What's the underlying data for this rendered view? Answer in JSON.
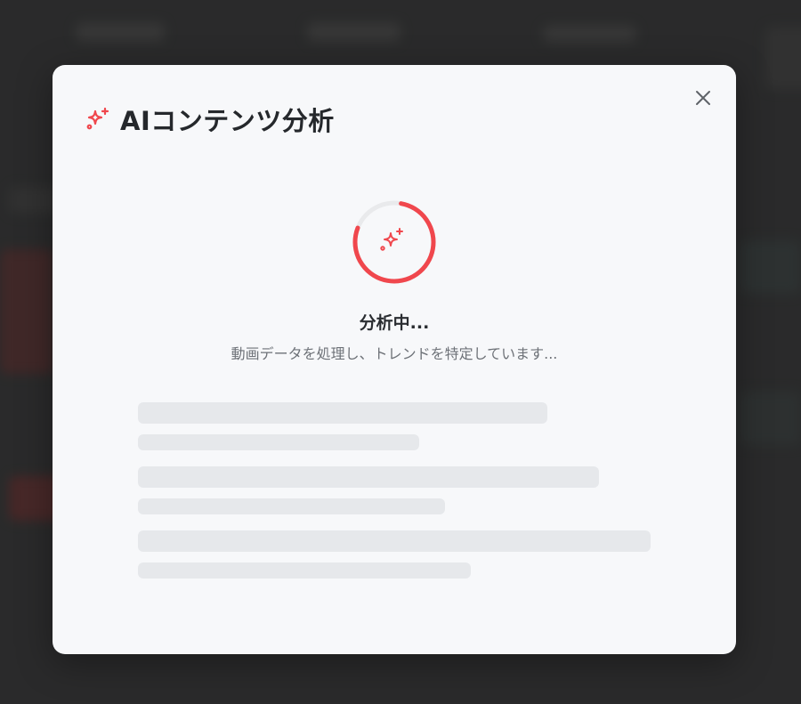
{
  "modal": {
    "title": "AIコンテンツ分析",
    "close_label": "×",
    "status_title": "分析中...",
    "status_subtitle": "動画データを処理し、トレンドを特定しています..."
  },
  "progress": {
    "fraction": 0.78
  },
  "colors": {
    "accent": "#f0474d",
    "skeleton": "#e6e8eb",
    "spinner_track": "#e9eaec"
  }
}
